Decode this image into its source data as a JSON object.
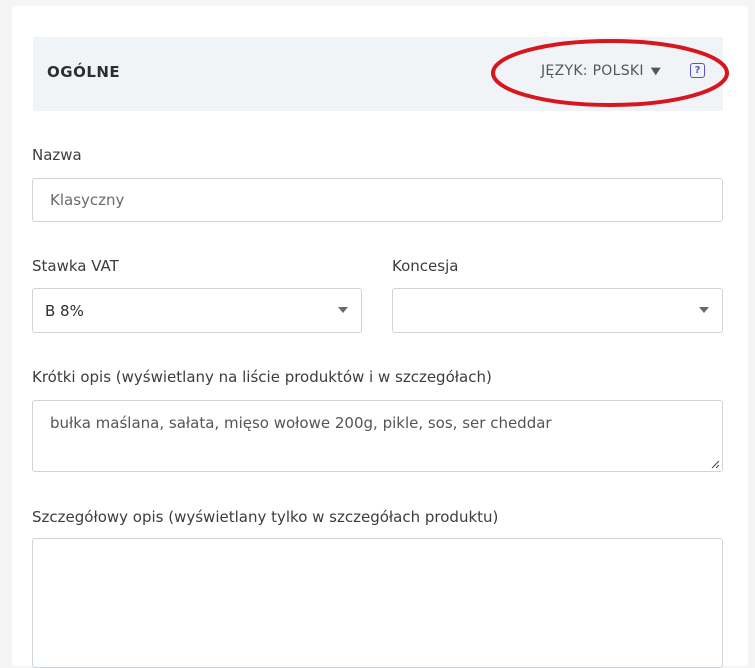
{
  "section": {
    "title": "OGÓLNE",
    "language_label": "JĘZYK: POLSKI",
    "language_chevron": "⌄",
    "help_glyph": "?"
  },
  "name_field": {
    "label": "Nazwa",
    "value": "Klasyczny"
  },
  "vat_field": {
    "label": "Stawka VAT",
    "value": "B 8%"
  },
  "concession_field": {
    "label": "Koncesja",
    "value": ""
  },
  "short_desc_field": {
    "label": "Krótki opis (wyświetlany na liście produktów i w szczegółach)",
    "value": "bułka maślana, sałata, mięso wołowe 200g, pikle, sos, ser cheddar"
  },
  "long_desc_field": {
    "label": "Szczegółowy opis (wyświetlany tylko w szczegółach produktu)",
    "value": ""
  },
  "colors": {
    "highlight_ellipse": "#d7161e",
    "help_icon": "#5b4fd6",
    "header_bg": "#f0f4f7"
  }
}
